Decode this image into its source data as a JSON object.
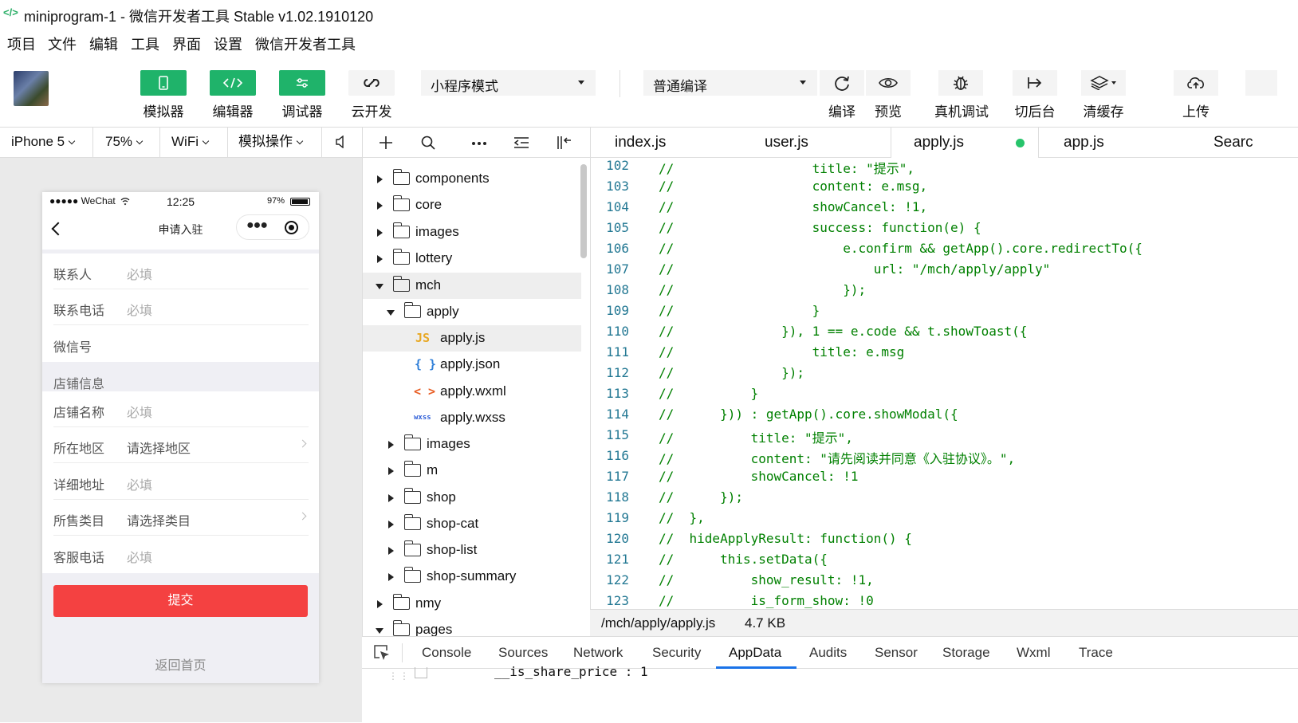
{
  "window": {
    "title": "miniprogram-1 - 微信开发者工具 Stable v1.02.1910120"
  },
  "menu": [
    "项目",
    "文件",
    "编辑",
    "工具",
    "界面",
    "设置",
    "微信开发者工具"
  ],
  "toolbar": {
    "simulator": "模拟器",
    "editor": "编辑器",
    "debugger": "调试器",
    "cloud": "云开发",
    "mode": "小程序模式",
    "compile_mode": "普通编译",
    "compile": "编译",
    "preview": "预览",
    "remote_debug": "真机调试",
    "background": "切后台",
    "clear_cache": "清缓存",
    "upload": "上传"
  },
  "simbar": {
    "device": "iPhone 5",
    "zoom": "75%",
    "network": "WiFi",
    "ops": "模拟操作"
  },
  "phone": {
    "carrier": "●●●●● WeChat",
    "time": "12:25",
    "battery": "97%",
    "nav_title": "申请入驻",
    "rows1": [
      {
        "label": "联系人",
        "value": "必填"
      },
      {
        "label": "联系电话",
        "value": "必填"
      },
      {
        "label": "微信号",
        "value": ""
      }
    ],
    "section_title": "店铺信息",
    "rows2": [
      {
        "label": "店铺名称",
        "value": "必填"
      },
      {
        "label": "所在地区",
        "value": "请选择地区"
      },
      {
        "label": "详细地址",
        "value": "必填"
      },
      {
        "label": "所售类目",
        "value": "请选择类目"
      },
      {
        "label": "客服电话",
        "value": "必填"
      }
    ],
    "submit": "提交",
    "back_home": "返回首页"
  },
  "tree": {
    "items": [
      {
        "name": "components"
      },
      {
        "name": "core"
      },
      {
        "name": "images"
      },
      {
        "name": "lottery"
      },
      {
        "name": "mch"
      },
      {
        "name": "apply"
      },
      {
        "name": "apply.js",
        "icon": "JS"
      },
      {
        "name": "apply.json",
        "icon": "{ }"
      },
      {
        "name": "apply.wxml",
        "icon": "< >"
      },
      {
        "name": "apply.wxss",
        "icon": "wxss"
      },
      {
        "name": "images"
      },
      {
        "name": "m"
      },
      {
        "name": "shop"
      },
      {
        "name": "shop-cat"
      },
      {
        "name": "shop-list"
      },
      {
        "name": "shop-summary"
      },
      {
        "name": "nmy"
      },
      {
        "name": "pages"
      }
    ]
  },
  "tabs": [
    "index.js",
    "user.js",
    "apply.js",
    "app.js",
    "Searc"
  ],
  "code": [
    {
      "n": "102",
      "t": "//                  title: \"提示\","
    },
    {
      "n": "103",
      "t": "//                  content: e.msg,"
    },
    {
      "n": "104",
      "t": "//                  showCancel: !1,"
    },
    {
      "n": "105",
      "t": "//                  success: function(e) {"
    },
    {
      "n": "106",
      "t": "//                      e.confirm && getApp().core.redirectTo({"
    },
    {
      "n": "107",
      "t": "//                          url: \"/mch/apply/apply\""
    },
    {
      "n": "108",
      "t": "//                      });"
    },
    {
      "n": "109",
      "t": "//                  }"
    },
    {
      "n": "110",
      "t": "//              }), 1 == e.code && t.showToast({"
    },
    {
      "n": "111",
      "t": "//                  title: e.msg"
    },
    {
      "n": "112",
      "t": "//              });"
    },
    {
      "n": "113",
      "t": "//          }"
    },
    {
      "n": "114",
      "t": "//      })) : getApp().core.showModal({"
    },
    {
      "n": "115",
      "t": "//          title: \"提示\","
    },
    {
      "n": "116",
      "t": "//          content: \"请先阅读并同意《入驻协议》。\","
    },
    {
      "n": "117",
      "t": "//          showCancel: !1"
    },
    {
      "n": "118",
      "t": "//      });"
    },
    {
      "n": "119",
      "t": "//  },"
    },
    {
      "n": "120",
      "t": "//  hideApplyResult: function() {"
    },
    {
      "n": "121",
      "t": "//      this.setData({"
    },
    {
      "n": "122",
      "t": "//          show_result: !1,"
    },
    {
      "n": "123",
      "t": "//          is_form_show: !0"
    }
  ],
  "path": {
    "file": "/mch/apply/apply.js",
    "size": "4.7 KB"
  },
  "devtools": {
    "tabs": [
      "Console",
      "Sources",
      "Network",
      "Security",
      "AppData",
      "Audits",
      "Sensor",
      "Storage",
      "Wxml",
      "Trace"
    ],
    "line": "__is_share_price : 1"
  },
  "colors": {
    "accent_green": "#1fb36a",
    "submit_red": "#f44141",
    "comment_green": "#008000",
    "active_tab_dot": "#27c46b"
  }
}
